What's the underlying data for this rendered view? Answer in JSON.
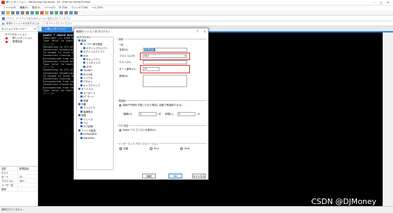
{
  "window": {
    "title": "新しいセッション - NetSarang Computer, Inc. (Free for Home/School)",
    "min": "–",
    "max": "□",
    "close": "✕"
  },
  "menu": [
    "ファイル(F)",
    "編集(E)",
    "表示(V)",
    "ツール(T)",
    "タブ(B)",
    "ウィンドウ(W)",
    "ヘルプ(H)"
  ],
  "addressbar": {
    "placeholder": "ホスト、IP アドレスまたはセッション名を入力してください"
  },
  "hintbar": {
    "text": "新規セッションを作成するには、ここをクリックしてください"
  },
  "session_panel": {
    "title": "セッションマネージャー",
    "close": "✕",
    "items": [
      "すべてのセッション",
      "新しいセッション",
      "新規会話"
    ]
  },
  "properties": {
    "rows": [
      {
        "k": "名前",
        "v": "新規会話"
      },
      {
        "k": "ホスト",
        "v": ""
      },
      {
        "k": "ポート",
        "v": "22"
      },
      {
        "k": "プロトコル",
        "v": "SSH"
      },
      {
        "k": "ユーザー名",
        "v": ""
      },
      {
        "k": "説明",
        "v": ""
      }
    ]
  },
  "tab": {
    "label": "1 新しいセッション"
  },
  "terminal": {
    "lines": [
      {
        "t": "Xshell 7 (Build 0113)",
        "c": "bold"
      },
      {
        "t": "Copyright (c) 2020 NetSarang",
        "c": ""
      },
      {
        "t": "",
        "c": ""
      },
      {
        "t": "Type `help' to learn how to use",
        "c": ""
      },
      {
        "t": "[C:\\~]$",
        "c": "cur"
      },
      {
        "t": "",
        "c": ""
      },
      {
        "t": "Connecting to 172.24.",
        "c": ""
      },
      {
        "t": "Connection established.",
        "c": ""
      },
      {
        "t": "To escape to local shell",
        "c": ""
      },
      {
        "t": "Connection closing...",
        "c": ""
      },
      {
        "t": "",
        "c": ""
      },
      {
        "t": "Disconnected from remote",
        "c": ""
      },
      {
        "t": "",
        "c": ""
      },
      {
        "t": "Connection closed by",
        "c": ""
      },
      {
        "t": "",
        "c": ""
      },
      {
        "t": "Type `help' to learn",
        "c": ""
      },
      {
        "t": "[C:\\~]$",
        "c": "cur"
      },
      {
        "t": "",
        "c": ""
      },
      {
        "t": "Connecting to 172.24.",
        "c": ""
      },
      {
        "t": "Connection established.",
        "c": ""
      },
      {
        "t": "To escape to local shell",
        "c": ""
      },
      {
        "t": "Connection closing...",
        "c": ""
      },
      {
        "t": "",
        "c": ""
      },
      {
        "t": "Disconnected from remote",
        "c": ""
      },
      {
        "t": "",
        "c": ""
      },
      {
        "t": "Connection closed by",
        "c": ""
      },
      {
        "t": "",
        "c": ""
      },
      {
        "t": "Disconnected from remote",
        "c": ""
      },
      {
        "t": "",
        "c": ""
      },
      {
        "t": "Type `help' to learn",
        "c": ""
      },
      {
        "t": "[C:\\~]$",
        "c": "cur"
      }
    ]
  },
  "statusbar": {
    "text": "接続されていません。"
  },
  "watermark": "CSDN @DJMoney",
  "dialog": {
    "title": "新規セッションのプロパティ",
    "help": "?",
    "close": "✕",
    "category_label": "カテゴリ(C):",
    "tree": [
      {
        "label": "接続",
        "lvl": 0
      },
      {
        "label": "ユーザー身元認証",
        "lvl": 1
      },
      {
        "label": "ログインプロンプト",
        "lvl": 2
      },
      {
        "label": "ログインスクリプト",
        "lvl": 1
      },
      {
        "label": "SSH",
        "lvl": 1
      },
      {
        "label": "セキュリティ",
        "lvl": 2
      },
      {
        "label": "トンネリング",
        "lvl": 2
      },
      {
        "label": "SFTP",
        "lvl": 2
      },
      {
        "label": "TELNET",
        "lvl": 1
      },
      {
        "label": "RLOGIN",
        "lvl": 1
      },
      {
        "label": "シリアル",
        "lvl": 1
      },
      {
        "label": "プロキシ",
        "lvl": 1
      },
      {
        "label": "キープアライブ",
        "lvl": 1
      },
      {
        "label": "ターミナル",
        "lvl": 0
      },
      {
        "label": "キーボード",
        "lvl": 1
      },
      {
        "label": "VT モード",
        "lvl": 1
      },
      {
        "label": "詳細",
        "lvl": 1
      },
      {
        "label": "外観",
        "lvl": 0
      },
      {
        "label": "ウィンドウ",
        "lvl": 1
      },
      {
        "label": "強調表示",
        "lvl": 1
      },
      {
        "label": "詳細",
        "lvl": 0
      },
      {
        "label": "トレース",
        "lvl": 1
      },
      {
        "label": "ベル",
        "lvl": 1
      },
      {
        "label": "ログ記録",
        "lvl": 1
      },
      {
        "label": "ファイル転送",
        "lvl": 0
      },
      {
        "label": "X/YMODEM",
        "lvl": 1
      },
      {
        "label": "ZMODEM",
        "lvl": 1
      }
    ],
    "section_connect": "接続",
    "section_general": "一般",
    "name_label": "名前(N):",
    "name_value": "新規会話",
    "protocol_label": "プロトコル(P):",
    "protocol_value": "SSH",
    "host_label": "ホスト(H):",
    "host_value": "",
    "port_label": "ポート番号(O):",
    "port_value": "22",
    "desc_label": "説明(D):",
    "reconnect_legend": "再接続",
    "reconnect_check": "接続が予期せず閉じられた場合に自動で再接続する(A)",
    "interval_label": "間隔(V):",
    "interval_value": "0",
    "sec_unit": "秒",
    "limit_label": "制限(L):",
    "limit_value": "0",
    "min_unit": "分",
    "tcp_legend": "TCP 設定",
    "nagle_check": "Nagle アルゴリズムを使用(U)",
    "ip_legend": "インターネットプロトコルバージョン",
    "ip_auto": "自動",
    "ip_v4": "IPv4",
    "ip_v6": "IPv6",
    "btn_connect": "接続",
    "btn_ok": "OK",
    "btn_cancel": "キャンセル"
  }
}
